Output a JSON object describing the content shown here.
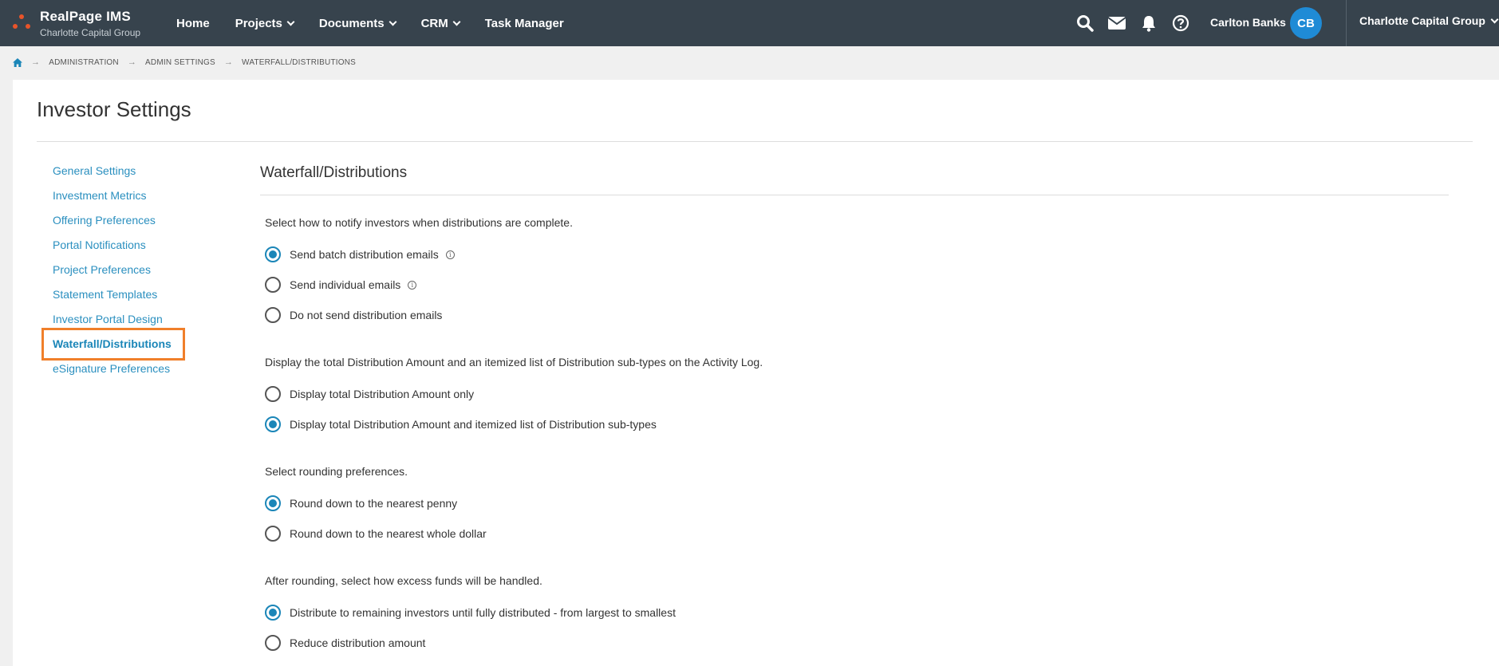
{
  "app": {
    "name": "RealPage IMS",
    "org_sub": "Charlotte Capital Group"
  },
  "nav": {
    "items": [
      {
        "label": "Home",
        "has_dropdown": false
      },
      {
        "label": "Projects",
        "has_dropdown": true
      },
      {
        "label": "Documents",
        "has_dropdown": true
      },
      {
        "label": "CRM",
        "has_dropdown": true
      },
      {
        "label": "Task Manager",
        "has_dropdown": false
      }
    ]
  },
  "header_right": {
    "icons": [
      "search-icon",
      "mail-icon",
      "bell-icon",
      "help-icon"
    ],
    "user_name": "Carlton Banks",
    "avatar_initials": "CB",
    "org_switcher": "Charlotte Capital Group"
  },
  "breadcrumb": {
    "home_icon": "home-icon",
    "items": [
      "ADMINISTRATION",
      "ADMIN SETTINGS",
      "WATERFALL/DISTRIBUTIONS"
    ]
  },
  "page": {
    "title": "Investor Settings"
  },
  "sidebar": {
    "items": [
      {
        "label": "General Settings"
      },
      {
        "label": "Investment Metrics"
      },
      {
        "label": "Offering Preferences"
      },
      {
        "label": "Portal Notifications"
      },
      {
        "label": "Project Preferences"
      },
      {
        "label": "Statement Templates"
      },
      {
        "label": "Investor Portal Design"
      },
      {
        "label": "Waterfall/Distributions"
      },
      {
        "label": "eSignature Preferences"
      }
    ],
    "active_index": 7
  },
  "section": {
    "title": "Waterfall/Distributions",
    "groups": [
      {
        "question": "Select how to notify investors when distributions are complete.",
        "options": [
          {
            "label": "Send batch distribution emails",
            "selected": true,
            "info": true
          },
          {
            "label": "Send individual emails",
            "selected": false,
            "info": true
          },
          {
            "label": "Do not send distribution emails",
            "selected": false,
            "info": false
          }
        ]
      },
      {
        "question": "Display the total Distribution Amount and an itemized list of Distribution sub-types on the Activity Log.",
        "options": [
          {
            "label": "Display total Distribution Amount only",
            "selected": false,
            "info": false
          },
          {
            "label": "Display total Distribution Amount and itemized list of Distribution sub-types",
            "selected": true,
            "info": false
          }
        ]
      },
      {
        "question": "Select rounding preferences.",
        "options": [
          {
            "label": "Round down to the nearest penny",
            "selected": true,
            "info": false
          },
          {
            "label": "Round down to the nearest whole dollar",
            "selected": false,
            "info": false
          }
        ]
      },
      {
        "question": "After rounding, select how excess funds will be handled.",
        "options": [
          {
            "label": "Distribute to remaining investors until fully distributed - from largest to smallest",
            "selected": true,
            "info": false
          },
          {
            "label": "Reduce distribution amount",
            "selected": false,
            "info": false
          }
        ]
      }
    ]
  },
  "colors": {
    "topbar": "#37434d",
    "link": "#2a8fbf",
    "radio_selected": "#1b86b8",
    "avatar": "#1f8bd6",
    "highlight": "#f07f2a",
    "logo": "#e8542a"
  }
}
